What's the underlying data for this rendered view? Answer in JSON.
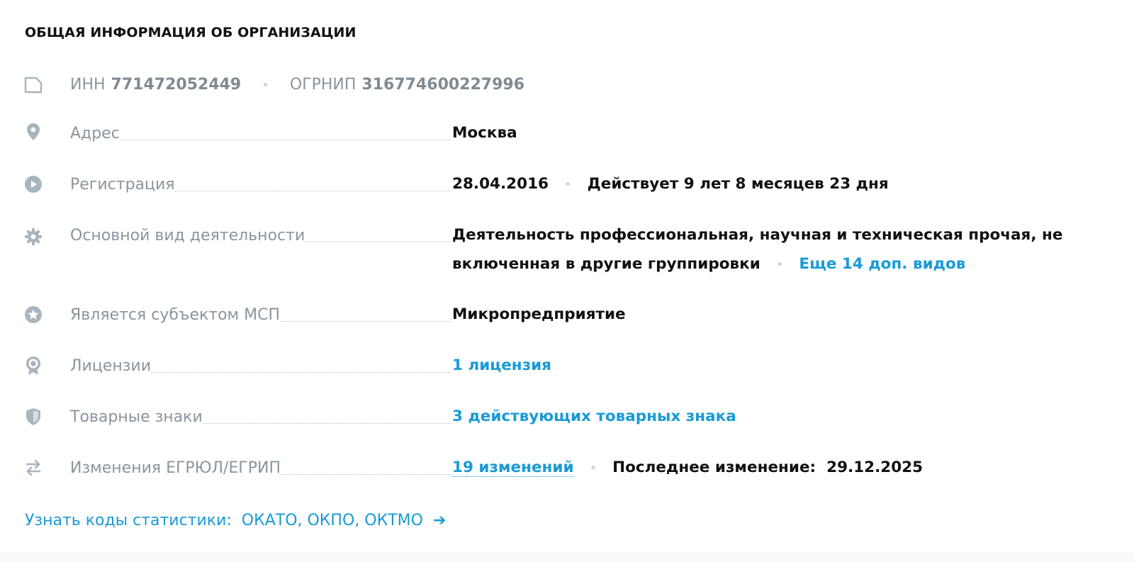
{
  "section": {
    "title": "ОБЩАЯ ИНФОРМАЦИЯ ОБ ОРГАНИЗАЦИИ"
  },
  "ids": {
    "inn_label": "ИНН",
    "inn_value": "771472052449",
    "ogrnip_label": "ОГРНИП",
    "ogrnip_value": "316774600227996",
    "separator": "•"
  },
  "rows": {
    "address": {
      "icon": "location-pin-icon",
      "label": "Адрес",
      "value": "Москва"
    },
    "registration": {
      "icon": "play-circle-icon",
      "label": "Регистрация",
      "date": "28.04.2016",
      "status": "Действует 9 лет 8 месяцев 23 дня"
    },
    "activity": {
      "icon": "gear-icon",
      "label": "Основной вид деятельности",
      "value": "Деятельность профессиональная, научная и техническая прочая, не включенная в другие группировки",
      "more_link": "Еще 14 доп. видов"
    },
    "msp": {
      "icon": "star-circle-icon",
      "label": "Является субъектом МСП",
      "value": "Микропредприятие"
    },
    "licenses": {
      "icon": "badge-icon",
      "label": "Лицензии",
      "value": "1 лицензия"
    },
    "trademarks": {
      "icon": "shield-icon",
      "label": "Товарные знаки",
      "value": "3 действующих товарных знака"
    },
    "changes": {
      "icon": "swap-arrows-icon",
      "label": "Изменения ЕГРЮЛ/ЕГРИП",
      "value": "19 изменений",
      "last_label": "Последнее изменение:",
      "last_date": "29.12.2025"
    }
  },
  "footer": {
    "link": "Узнать коды статистики:  ОКАТО, ОКПО, ОКТМО",
    "arrow": "➔"
  },
  "colors": {
    "accent": "#1a9ad6",
    "label": "#8a959e",
    "value": "#111111",
    "icon": "#a9b4bc"
  }
}
